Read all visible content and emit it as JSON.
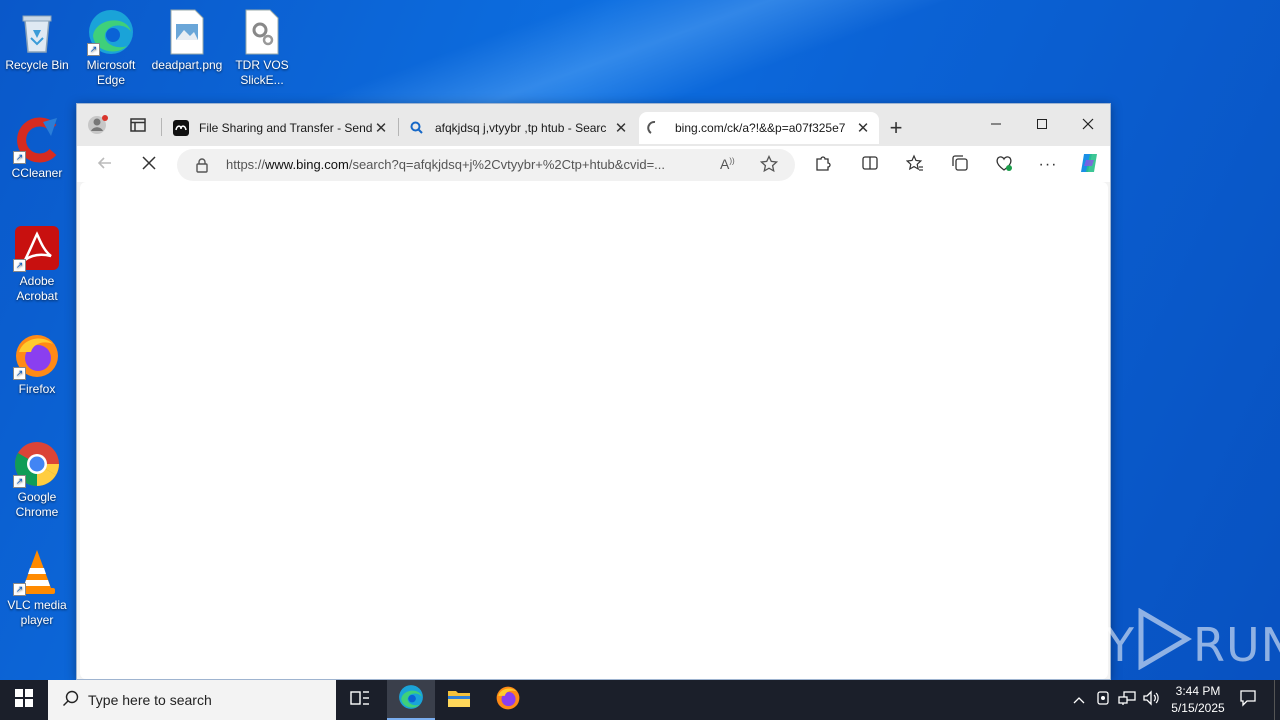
{
  "desktop": {
    "icons": [
      {
        "label": "Recycle Bin"
      },
      {
        "label": "Microsoft Edge"
      },
      {
        "label": "deadpart.png"
      },
      {
        "label": "TDR VOS SlickE..."
      },
      {
        "label": "CCleaner"
      },
      {
        "label": "Adobe Acrobat"
      },
      {
        "label": "Firefox"
      },
      {
        "label": "Google Chrome"
      },
      {
        "label": "VLC media player"
      }
    ],
    "watermark": {
      "left": "ANY",
      "right": "RUN"
    }
  },
  "browser": {
    "tabs": [
      {
        "title": "File Sharing and Transfer - Send L",
        "close": "✕"
      },
      {
        "title": "afqkjdsq j,vtyybr ,tp htub - Searc",
        "close": "✕"
      },
      {
        "title": "bing.com/ck/a?!&&p=a07f325e7",
        "close": "✕",
        "active": true
      }
    ],
    "new_tab": "+",
    "address": {
      "prefix": "https://",
      "domain": "www.bing.com",
      "path": "/search?q=afqkjdsq+j%2Cvtyybr+%2Ctp+htub&cvid=..."
    }
  },
  "taskbar": {
    "search_placeholder": "Type here to search",
    "time": "3:44 PM",
    "date": "5/15/2025"
  },
  "colors": {
    "desktop": "#0b63d6",
    "taskbar": "#1b1f2a",
    "edge_accent": "#0f7bd9"
  }
}
